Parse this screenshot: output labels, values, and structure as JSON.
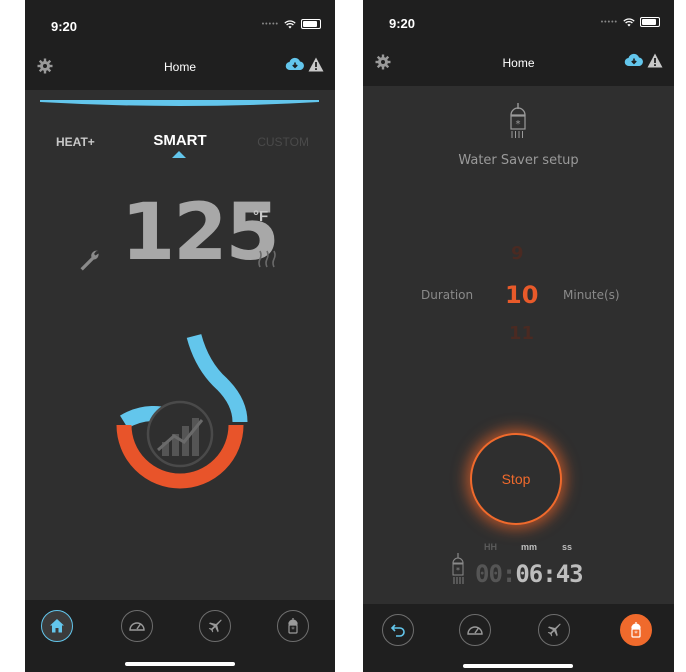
{
  "left_screen": {
    "status_time": "9:20",
    "nav_title": "Home",
    "modes": [
      "HEAT+",
      "SMART",
      "CUSTOM"
    ],
    "selected_mode": "SMART",
    "temperature": "125",
    "temperature_unit": "°F",
    "tabs": [
      "home-icon",
      "gauge-icon",
      "jet-icon",
      "shower-icon"
    ],
    "active_tab": "home-icon"
  },
  "right_screen": {
    "status_time": "9:20",
    "nav_title": "Home",
    "setup_title": "Water Saver setup",
    "duration_label": "Duration",
    "minutes_label": "Minute(s)",
    "picker_values": [
      "9",
      "10",
      "11"
    ],
    "picker_selected": "10",
    "stop_label": "Stop",
    "timer_headers": {
      "hh": "HH",
      "mm": "mm",
      "ss": "ss"
    },
    "timer": {
      "hh": "00",
      "colon1": ":",
      "mm_ss": "06:43"
    },
    "tabs": [
      "back-icon",
      "gauge-icon",
      "jet-icon",
      "shower-icon"
    ],
    "active_tab": "shower-icon"
  },
  "colors": {
    "accent_blue": "#63c6ec",
    "accent_orange": "#f06a2c",
    "dark_bg": "#2f2f2f",
    "bar_bg": "#1f1f1f"
  }
}
